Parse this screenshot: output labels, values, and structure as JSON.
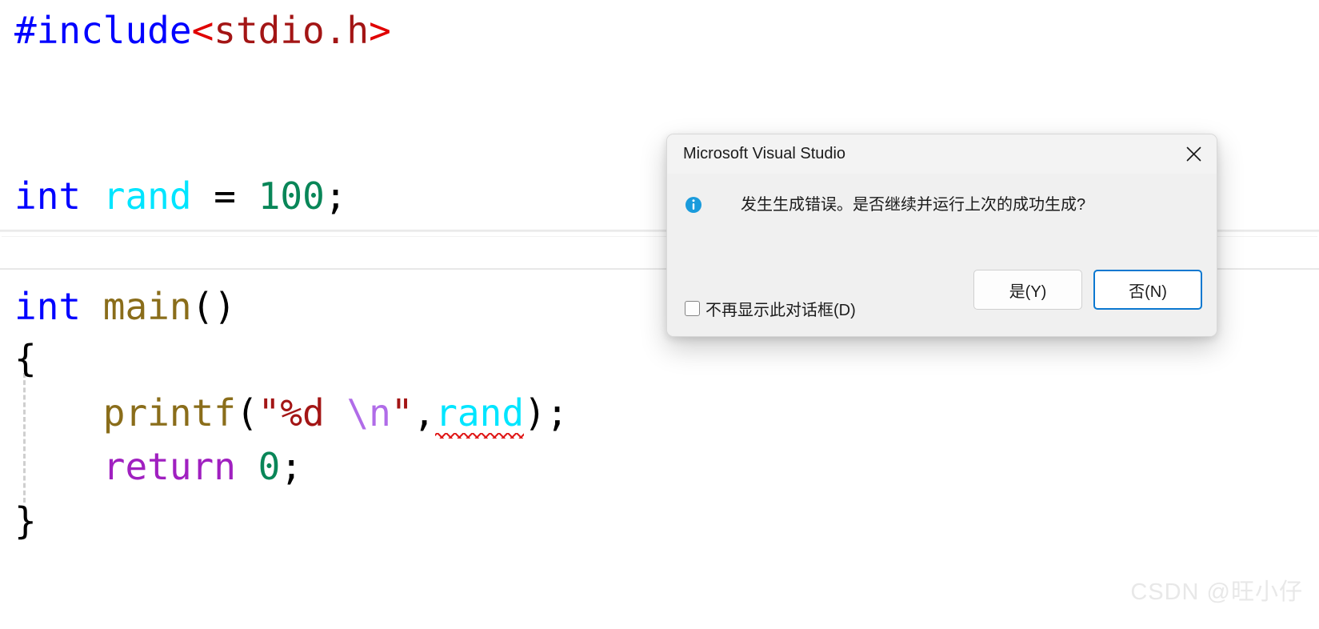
{
  "editor": {
    "language": "c",
    "lines": [
      {
        "id": "line-include",
        "tokens": [
          {
            "text": "#include",
            "kind": "macro"
          },
          {
            "text": "<",
            "kind": "angle"
          },
          {
            "text": "stdio.h",
            "kind": "header"
          },
          {
            "text": ">",
            "kind": "angle"
          }
        ]
      },
      {
        "id": "line-global-rand",
        "tokens": [
          {
            "text": "int",
            "kind": "kw"
          },
          {
            "text": " ",
            "kind": "punct"
          },
          {
            "text": "rand",
            "kind": "var"
          },
          {
            "text": " ",
            "kind": "punct"
          },
          {
            "text": "=",
            "kind": "punct"
          },
          {
            "text": " ",
            "kind": "punct"
          },
          {
            "text": "100",
            "kind": "num"
          },
          {
            "text": ";",
            "kind": "punct"
          }
        ]
      },
      {
        "id": "line-main-sig",
        "tokens": [
          {
            "text": "int",
            "kind": "kw"
          },
          {
            "text": " ",
            "kind": "punct"
          },
          {
            "text": "main",
            "kind": "fn"
          },
          {
            "text": "()",
            "kind": "punct"
          }
        ]
      },
      {
        "id": "line-open-brace",
        "tokens": [
          {
            "text": "{",
            "kind": "punct"
          }
        ]
      },
      {
        "id": "line-printf",
        "tokens": [
          {
            "text": "    ",
            "kind": "punct"
          },
          {
            "text": "printf",
            "kind": "fn"
          },
          {
            "text": "(",
            "kind": "punct"
          },
          {
            "text": "\"%d ",
            "kind": "str"
          },
          {
            "text": "\\n",
            "kind": "esc"
          },
          {
            "text": "\"",
            "kind": "str"
          },
          {
            "text": ",",
            "kind": "punct"
          },
          {
            "text": "rand",
            "kind": "var",
            "squiggle": true
          },
          {
            "text": ")",
            "kind": "punct"
          },
          {
            "text": ";",
            "kind": "punct"
          }
        ]
      },
      {
        "id": "line-return",
        "tokens": [
          {
            "text": "    ",
            "kind": "punct"
          },
          {
            "text": "return",
            "kind": "ret"
          },
          {
            "text": " ",
            "kind": "punct"
          },
          {
            "text": "0",
            "kind": "num"
          },
          {
            "text": ";",
            "kind": "punct"
          }
        ]
      },
      {
        "id": "line-close-brace",
        "tokens": [
          {
            "text": "}",
            "kind": "punct"
          }
        ]
      }
    ],
    "plain_text": "#include<stdio.h>\n\nint rand = 100;\n\nint main()\n{\n    printf(\"%d \\n\",rand);\n    return 0;\n}",
    "colors": {
      "keyword": "#0000ff",
      "identifier": "#00e5ff",
      "number": "#098658",
      "function": "#8a6d1a",
      "string": "#a31515",
      "escape": "#b06ce8",
      "return_keyword": "#a020c0",
      "angle_bracket": "#e00000",
      "error_squiggle": "#e01b1b",
      "punctuation": "#000000",
      "background": "#ffffff",
      "indent_guide": "#cfcfcf"
    }
  },
  "strip": {
    "name": "editor-horizontal-strip",
    "background": "#ffffff",
    "border": "#e6e6e6"
  },
  "dialog": {
    "title": "Microsoft Visual Studio",
    "icon": "info-icon",
    "message": "发生生成错误。是否继续并运行上次的成功生成?",
    "close_label": "×",
    "buttons": [
      {
        "id": "yes",
        "label": "是(Y)",
        "default": false
      },
      {
        "id": "no",
        "label": "否(N)",
        "default": true
      }
    ],
    "checkbox": {
      "label": "不再显示此对话框(D)",
      "checked": false
    },
    "colors": {
      "titlebar": "#f3f3f3",
      "body": "#f0f0f0",
      "border": "#d8d8d8",
      "default_button_border": "#0b78d0",
      "info_icon": "#1a9bdc"
    }
  },
  "watermark": {
    "text": "CSDN @旺小仔",
    "color": "#e8e8e8"
  }
}
